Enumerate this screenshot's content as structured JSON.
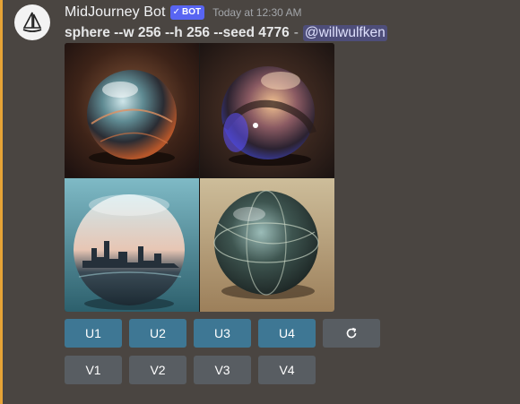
{
  "message": {
    "author": "MidJourney Bot",
    "bot_tag": "BOT",
    "bot_check": "✓",
    "timestamp": "Today at 12:30 AM",
    "prompt": "sphere --w 256 --h 256 --seed 4776",
    "separator": "-",
    "mention": "@willwulfken"
  },
  "image_grid": {
    "tiles": [
      {
        "icon": "sphere-image-1"
      },
      {
        "icon": "sphere-image-2"
      },
      {
        "icon": "sphere-image-3"
      },
      {
        "icon": "sphere-image-4"
      }
    ]
  },
  "buttons": {
    "upscale": [
      "U1",
      "U2",
      "U3",
      "U4"
    ],
    "reroll_icon": "refresh-icon",
    "variation": [
      "V1",
      "V2",
      "V3",
      "V4"
    ]
  },
  "colors": {
    "background": "#4a4541",
    "highlight": "#e6a336",
    "upscale_button": "#3e7794",
    "variation_button": "#585d62",
    "bot_tag": "#5865f2"
  }
}
